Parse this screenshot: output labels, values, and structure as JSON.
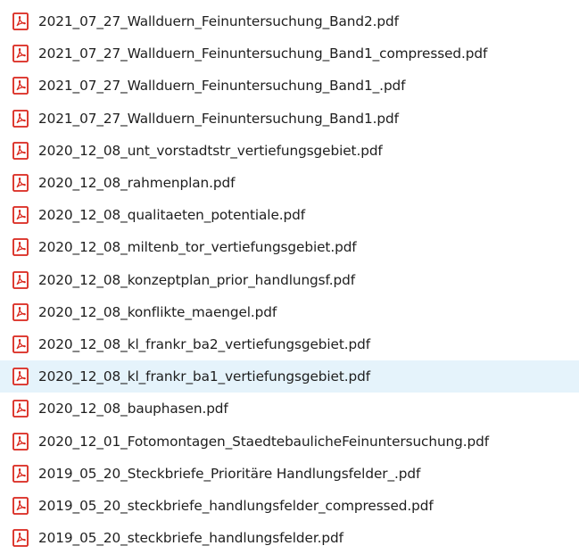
{
  "files": [
    {
      "name": "2021_07_27_Wallduern_Feinuntersuchung_Band2.pdf",
      "icon": "pdf-file-icon"
    },
    {
      "name": "2021_07_27_Wallduern_Feinuntersuchung_Band1_compressed.pdf",
      "icon": "pdf-file-icon"
    },
    {
      "name": "2021_07_27_Wallduern_Feinuntersuchung_Band1_.pdf",
      "icon": "pdf-file-icon"
    },
    {
      "name": "2021_07_27_Wallduern_Feinuntersuchung_Band1.pdf",
      "icon": "pdf-file-icon"
    },
    {
      "name": "2020_12_08_unt_vorstadtstr_vertiefungsgebiet.pdf",
      "icon": "pdf-file-icon"
    },
    {
      "name": "2020_12_08_rahmenplan.pdf",
      "icon": "pdf-file-icon"
    },
    {
      "name": "2020_12_08_qualitaeten_potentiale.pdf",
      "icon": "pdf-file-icon"
    },
    {
      "name": "2020_12_08_miltenb_tor_vertiefungsgebiet.pdf",
      "icon": "pdf-file-icon"
    },
    {
      "name": "2020_12_08_konzeptplan_prior_handlungsf.pdf",
      "icon": "pdf-file-icon"
    },
    {
      "name": "2020_12_08_konflikte_maengel.pdf",
      "icon": "pdf-file-icon"
    },
    {
      "name": "2020_12_08_kl_frankr_ba2_vertiefungsgebiet.pdf",
      "icon": "pdf-file-icon"
    },
    {
      "name": "2020_12_08_kl_frankr_ba1_vertiefungsgebiet.pdf",
      "icon": "pdf-file-icon",
      "hovered": true
    },
    {
      "name": "2020_12_08_bauphasen.pdf",
      "icon": "pdf-file-icon"
    },
    {
      "name": "2020_12_01_Fotomontagen_StaedtebaulicheFeinuntersuchung.pdf",
      "icon": "pdf-file-icon"
    },
    {
      "name": "2019_05_20_Steckbriefe_Prioritäre Handlungsfelder_.pdf",
      "icon": "pdf-file-icon"
    },
    {
      "name": "2019_05_20_steckbriefe_handlungsfelder_compressed.pdf",
      "icon": "pdf-file-icon"
    },
    {
      "name": "2019_05_20_steckbriefe_handlungsfelder.pdf",
      "icon": "pdf-file-icon"
    }
  ],
  "colors": {
    "pdf_icon_red": "#d9261c",
    "hover_background": "#e5f3fb",
    "text": "#1e1e1e"
  }
}
